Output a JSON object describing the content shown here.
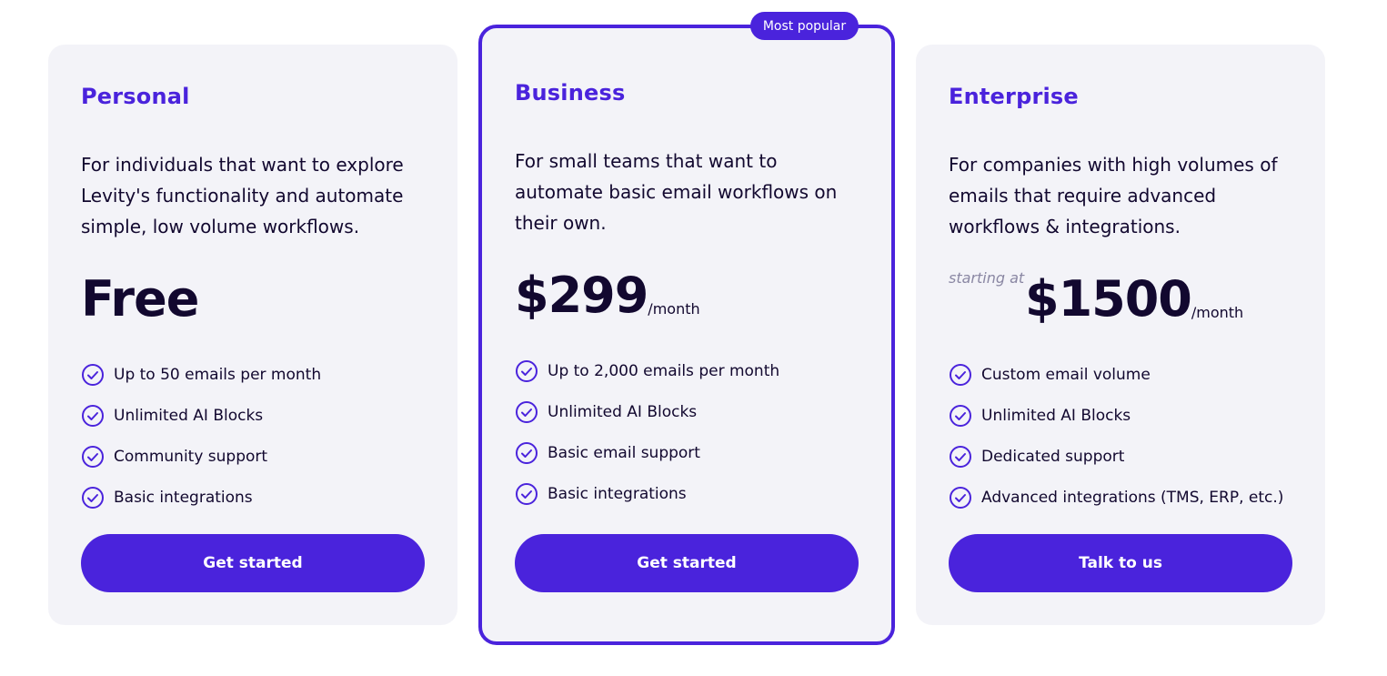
{
  "colors": {
    "accent": "#4a23dc",
    "card_bg": "#f3f3f8",
    "text": "#12082f",
    "muted": "#8a87a3"
  },
  "badge": "Most popular",
  "plans": [
    {
      "name": "Personal",
      "description": "For individuals that want to explore Levity's functionality and automate simple, low volume workflows.",
      "price_prefix": "",
      "price": "Free",
      "period": "",
      "features": [
        "Up to 50 emails per month",
        "Unlimited AI Blocks",
        "Community support",
        "Basic integrations"
      ],
      "cta": "Get started"
    },
    {
      "name": "Business",
      "description": "For small teams that want to automate basic email workflows on their own.",
      "price_prefix": "",
      "price": "$299",
      "period": "/month",
      "features": [
        "Up to 2,000 emails per month",
        "Unlimited AI Blocks",
        "Basic email support",
        "Basic integrations"
      ],
      "cta": "Get started"
    },
    {
      "name": "Enterprise",
      "description": "For companies with high volumes of emails that require advanced workflows & integrations.",
      "price_prefix": "starting at",
      "price": "$1500",
      "period": "/month",
      "features": [
        "Custom email volume",
        "Unlimited AI Blocks",
        "Dedicated support",
        "Advanced integrations (TMS, ERP, etc.)"
      ],
      "cta": "Talk to us"
    }
  ],
  "icons": {
    "feature": "check-circle-icon"
  }
}
